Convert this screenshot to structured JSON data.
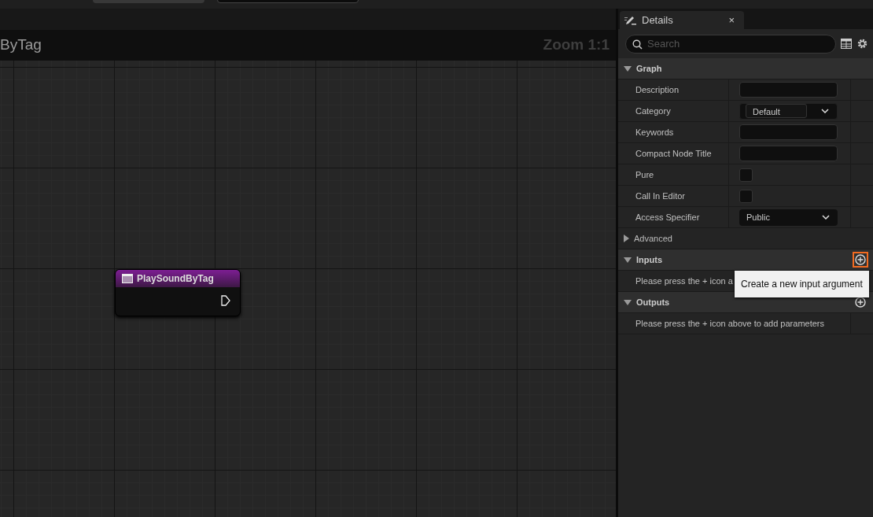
{
  "graph": {
    "title": "ByTag",
    "zoom": "Zoom 1:1",
    "nodes": [
      {
        "title": "PlaySoundByTag"
      }
    ]
  },
  "details": {
    "tab": {
      "label": "Details",
      "close": "×"
    },
    "search": {
      "placeholder": "Search"
    },
    "sections": [
      {
        "kind": "category",
        "title": "Graph",
        "expanded": true,
        "rows": [
          {
            "kind": "text",
            "label": "Description"
          },
          {
            "kind": "combo",
            "label": "Category",
            "value": "Default"
          },
          {
            "kind": "text",
            "label": "Keywords"
          },
          {
            "kind": "text",
            "label": "Compact Node Title"
          },
          {
            "kind": "checkbox",
            "label": "Pure",
            "checked": false
          },
          {
            "kind": "checkbox",
            "label": "Call In Editor",
            "checked": false
          },
          {
            "kind": "select",
            "label": "Access Specifier",
            "value": "Public"
          }
        ]
      },
      {
        "kind": "group",
        "title": "Advanced",
        "expanded": false
      },
      {
        "kind": "category",
        "title": "Inputs",
        "expanded": true,
        "add_button": true,
        "hovered": true,
        "message": "Please press the + icon a"
      },
      {
        "kind": "category",
        "title": "Outputs",
        "expanded": true,
        "add_button": true,
        "hovered": false,
        "message": "Please press the + icon above to add parameters"
      }
    ]
  },
  "tooltip": {
    "text": "Create a new input argument"
  }
}
